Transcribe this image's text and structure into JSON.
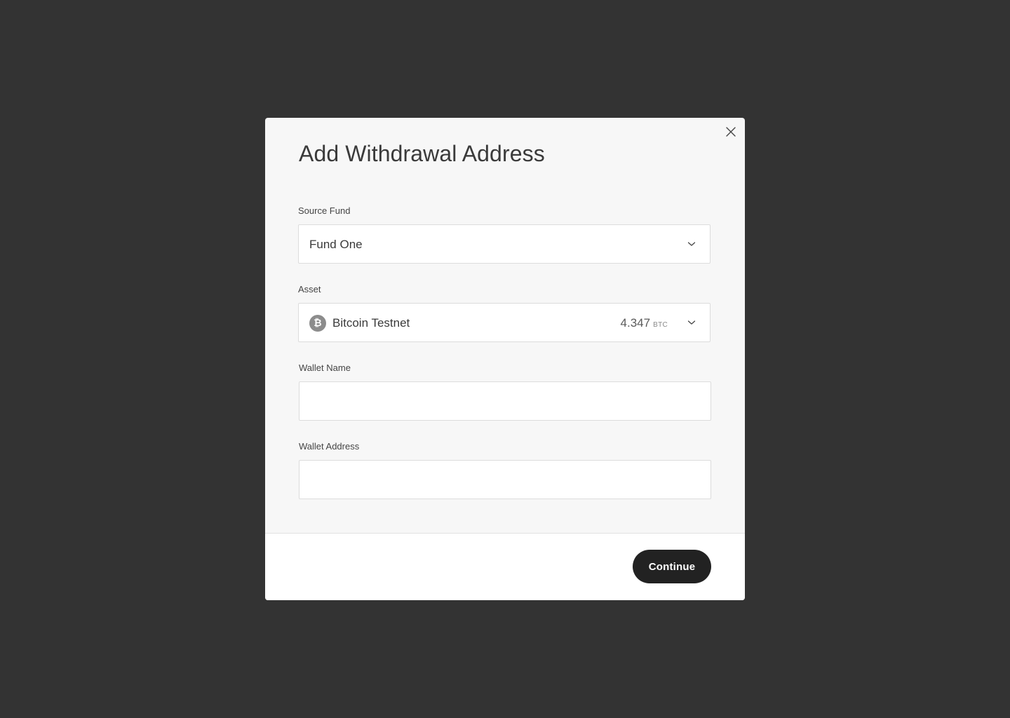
{
  "modal": {
    "title": "Add Withdrawal Address",
    "close_icon": "close-icon"
  },
  "source_fund": {
    "label": "Source Fund",
    "selected": "Fund One"
  },
  "asset": {
    "label": "Asset",
    "icon": "bitcoin-icon",
    "icon_glyph": "₿",
    "name": "Bitcoin Testnet",
    "balance": "4.347",
    "unit": "BTC"
  },
  "wallet_name": {
    "label": "Wallet Name",
    "value": "",
    "placeholder": ""
  },
  "wallet_address": {
    "label": "Wallet Address",
    "value": "",
    "placeholder": ""
  },
  "footer": {
    "continue_label": "Continue"
  },
  "colors": {
    "backdrop": "#333333",
    "modal_background": "#f7f7f7",
    "primary_button": "#222222",
    "coin_icon": "#8c8c8c"
  }
}
